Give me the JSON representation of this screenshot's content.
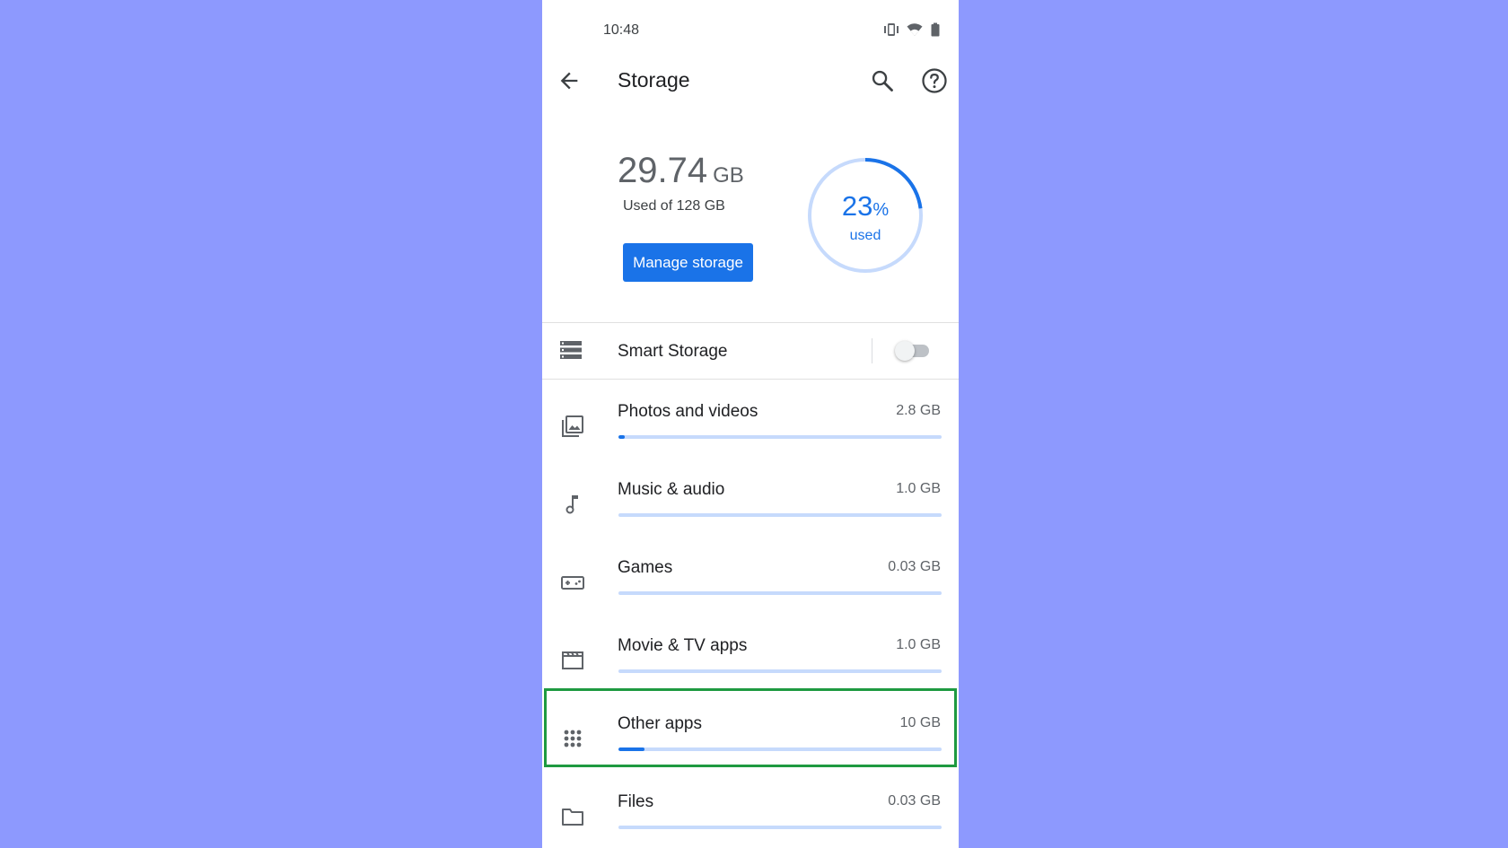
{
  "status_bar": {
    "time": "10:48",
    "icons": [
      "vibrate-icon",
      "wifi-icon",
      "battery-icon"
    ]
  },
  "app_bar": {
    "title": "Storage",
    "back_icon": "arrow-back-icon",
    "search_icon": "search-icon",
    "help_icon": "help-icon"
  },
  "summary": {
    "used_value": "29.74",
    "used_unit": "GB",
    "used_of": "Used of 128 GB",
    "manage_label": "Manage storage",
    "percent_value": "23",
    "percent_symbol": "%",
    "percent_label": "used",
    "percent_fraction": 0.23
  },
  "smart_storage": {
    "label": "Smart Storage",
    "enabled": false
  },
  "categories": [
    {
      "label": "Photos and videos",
      "size": "2.8 GB",
      "icon": "photos-icon",
      "fraction": 0.02
    },
    {
      "label": "Music & audio",
      "size": "1.0 GB",
      "icon": "music-note-icon",
      "fraction": 0.0
    },
    {
      "label": "Games",
      "size": "0.03 GB",
      "icon": "gamepad-icon",
      "fraction": 0.0
    },
    {
      "label": "Movie & TV apps",
      "size": "1.0 GB",
      "icon": "movie-icon",
      "fraction": 0.0
    },
    {
      "label": "Other apps",
      "size": "10 GB",
      "icon": "apps-grid-icon",
      "fraction": 0.08
    },
    {
      "label": "Files",
      "size": "0.03 GB",
      "icon": "folder-icon",
      "fraction": 0.0
    }
  ],
  "colors": {
    "accent": "#1a73e8",
    "track": "#c6dafc",
    "background": "#8d99fe",
    "highlight": "#1e9a41"
  }
}
